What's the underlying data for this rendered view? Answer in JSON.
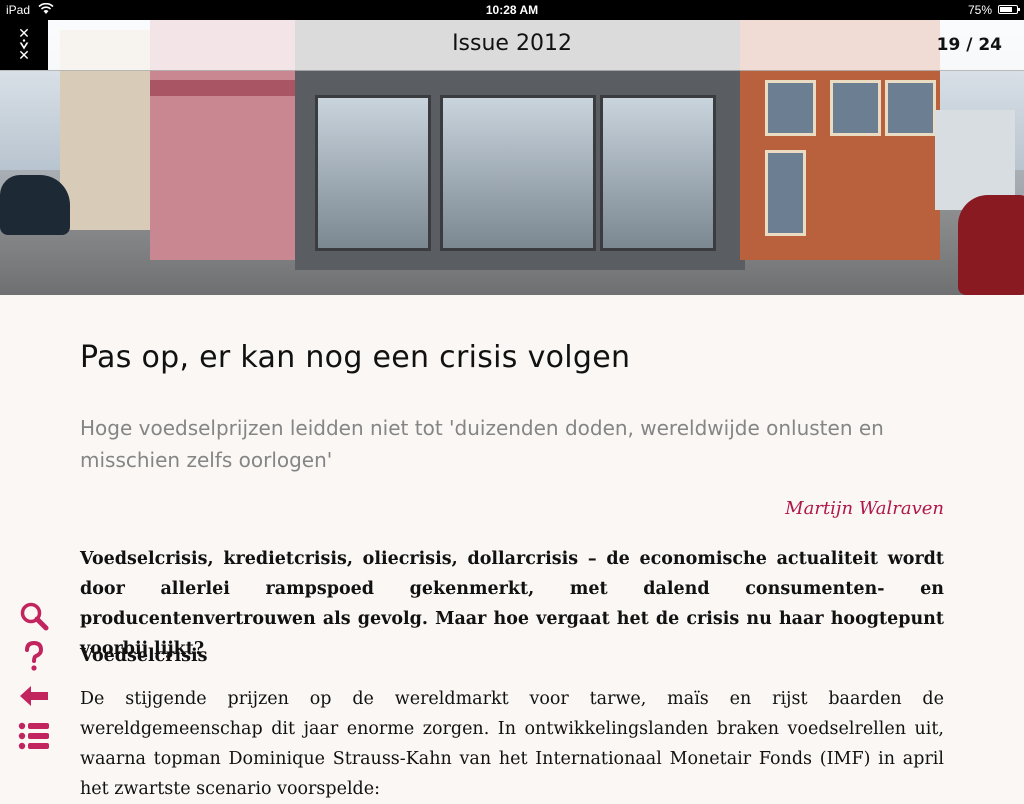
{
  "status_bar": {
    "device": "iPad",
    "time": "10:28 AM",
    "battery": "75%",
    "battery_level": 0.75
  },
  "header": {
    "issue_title": "Issue 2012",
    "page_indicator": "19 / 24"
  },
  "article": {
    "headline": "Pas op, er kan nog een crisis volgen",
    "subtitle": "Hoge voedselprijzen leidden niet tot 'duizenden doden, wereldwijde onlusten en misschien zelfs oorlogen'",
    "author": "Martijn Walraven",
    "lead": "Voedselcrisis, kredietcrisis, oliecrisis, dollarcrisis – de economische actualiteit wordt door allerlei rampspoed gekenmerkt, met dalend consumenten- en producentenvertrouwen als gevolg. Maar hoe vergaat het de crisis nu haar hoogtepunt voorbij lijkt?",
    "section_heading": "Voedselcrisis",
    "body": "De stijgende prijzen op de wereldmarkt voor tarwe, maïs en rijst baarden de wereldgemeenschap dit jaar enorme zorgen. In ontwikkelingslanden braken voedselrellen uit, waarna topman Dominique Strauss-Kahn van het Internationaal Monetair Fonds (IMF) in april het zwartste scenario voorspelde:"
  },
  "colors": {
    "accent": "#b0174a",
    "background": "#faf7f4",
    "subtitle": "#858585"
  },
  "toolbar": {
    "icons": [
      "search-icon",
      "help-icon",
      "back-arrow-icon",
      "list-icon"
    ]
  }
}
